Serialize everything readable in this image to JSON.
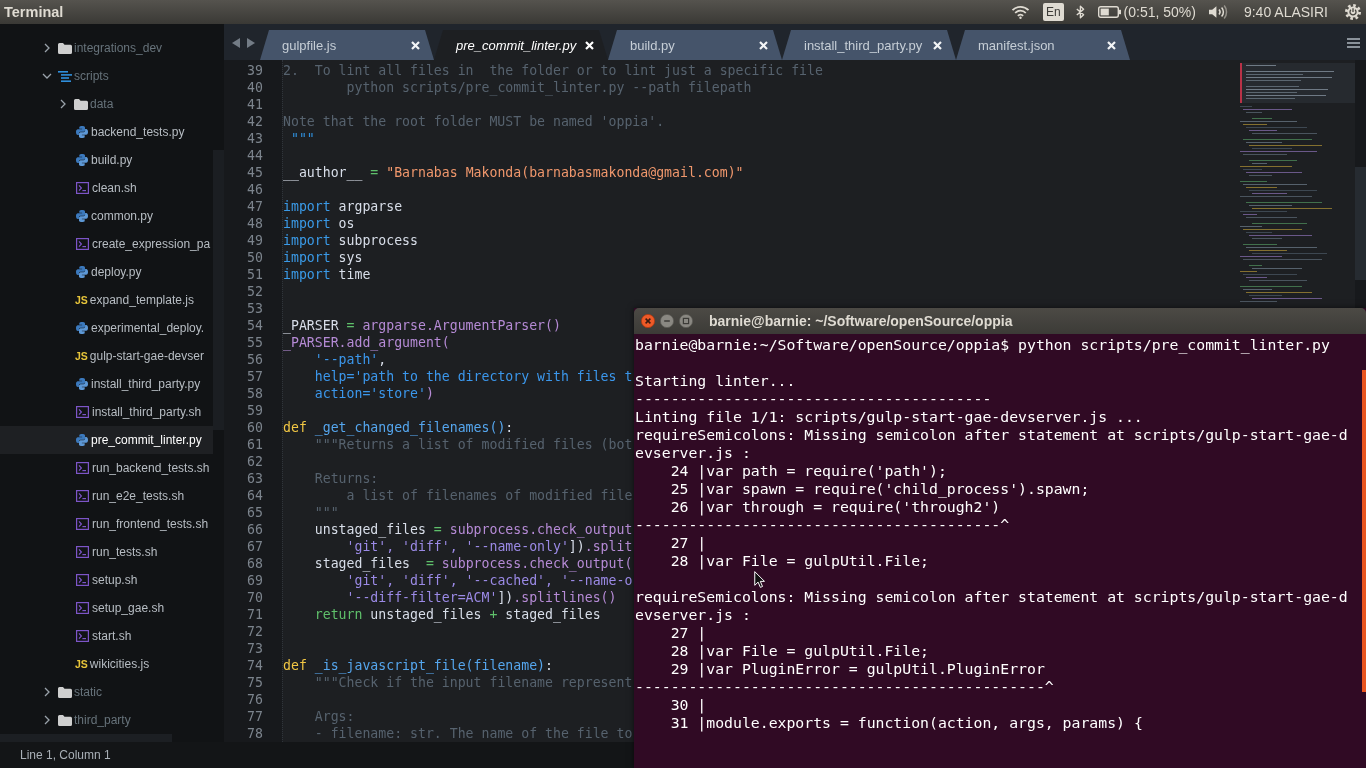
{
  "top_panel": {
    "app_title": "Terminal",
    "keyboard_layout": "En",
    "battery": "(0:51, 50%)",
    "clock": "9:40 ALASIRI"
  },
  "editor": {
    "sidebar": {
      "items": [
        {
          "label": "integrations_dev",
          "kind": "folder",
          "expanded": false,
          "selected": false
        },
        {
          "label": "scripts",
          "kind": "folder",
          "expanded": true,
          "selected": false,
          "children": [
            {
              "label": "data",
              "kind": "folder",
              "expanded": false,
              "selected": false
            },
            {
              "label": "backend_tests.py",
              "kind": "python",
              "selected": false
            },
            {
              "label": "build.py",
              "kind": "python",
              "selected": false
            },
            {
              "label": "clean.sh",
              "kind": "shell",
              "selected": false
            },
            {
              "label": "common.py",
              "kind": "python",
              "selected": false
            },
            {
              "label": "create_expression_pa",
              "kind": "shell",
              "selected": false
            },
            {
              "label": "deploy.py",
              "kind": "python",
              "selected": false
            },
            {
              "label": "expand_template.js",
              "kind": "javascript",
              "icon_label": "JS",
              "selected": false
            },
            {
              "label": "experimental_deploy.",
              "kind": "python",
              "selected": false
            },
            {
              "label": "gulp-start-gae-devser",
              "kind": "javascript",
              "icon_label": "JS",
              "selected": false
            },
            {
              "label": "install_third_party.py",
              "kind": "python",
              "selected": false
            },
            {
              "label": "install_third_party.sh",
              "kind": "shell",
              "selected": false
            },
            {
              "label": "pre_commit_linter.py",
              "kind": "python",
              "selected": true
            },
            {
              "label": "run_backend_tests.sh",
              "kind": "shell",
              "selected": false
            },
            {
              "label": "run_e2e_tests.sh",
              "kind": "shell",
              "selected": false
            },
            {
              "label": "run_frontend_tests.sh",
              "kind": "shell",
              "selected": false
            },
            {
              "label": "run_tests.sh",
              "kind": "shell",
              "selected": false
            },
            {
              "label": "setup.sh",
              "kind": "shell",
              "selected": false
            },
            {
              "label": "setup_gae.sh",
              "kind": "shell",
              "selected": false
            },
            {
              "label": "start.sh",
              "kind": "shell",
              "selected": false
            },
            {
              "label": "wikicities.js",
              "kind": "javascript",
              "icon_label": "JS",
              "selected": false
            }
          ]
        },
        {
          "label": "static",
          "kind": "folder",
          "expanded": false,
          "selected": false
        },
        {
          "label": "third_party",
          "kind": "folder",
          "expanded": false,
          "selected": false
        }
      ]
    },
    "tabs": [
      {
        "label": "gulpfile.js",
        "selected": false
      },
      {
        "label": "pre_commit_linter.py",
        "selected": true
      },
      {
        "label": "build.py",
        "selected": false
      },
      {
        "label": "install_third_party.py",
        "selected": false
      },
      {
        "label": "manifest.json",
        "selected": false
      }
    ],
    "lines": [
      {
        "number": "39",
        "tokens": [
          {
            "text": "2.  To lint all files in  the folder or to lint just a specific file",
            "kind": "comment"
          }
        ]
      },
      {
        "number": "40",
        "tokens": [
          {
            "text": "        python scripts/pre_commit_linter.py --path filepath",
            "kind": "comment"
          }
        ]
      },
      {
        "number": "41"
      },
      {
        "number": "42",
        "tokens": [
          {
            "text": "Note that the root folder MUST be named 'oppia'.",
            "kind": "comment"
          }
        ]
      },
      {
        "number": "43",
        "tokens": [
          {
            "text": " \"\"\"",
            "kind": "delimiter"
          }
        ]
      },
      {
        "number": "44"
      },
      {
        "number": "45",
        "tokens": [
          {
            "text": "__author__",
            "kind": "plain"
          },
          {
            "text": " = ",
            "kind": "operator"
          },
          {
            "text": "\"Barnabas Makonda(barnabasmakonda@gmail.com)\"",
            "kind": "string"
          }
        ]
      },
      {
        "number": "46"
      },
      {
        "number": "47",
        "tokens": [
          {
            "text": "import",
            "kind": "keyword"
          },
          {
            "text": " argparse",
            "kind": "plain"
          }
        ]
      },
      {
        "number": "48",
        "tokens": [
          {
            "text": "import",
            "kind": "keyword"
          },
          {
            "text": " os",
            "kind": "plain"
          }
        ]
      },
      {
        "number": "49",
        "tokens": [
          {
            "text": "import",
            "kind": "keyword"
          },
          {
            "text": " subprocess",
            "kind": "plain"
          }
        ]
      },
      {
        "number": "50",
        "tokens": [
          {
            "text": "import",
            "kind": "keyword"
          },
          {
            "text": " sys",
            "kind": "plain"
          }
        ]
      },
      {
        "number": "51",
        "tokens": [
          {
            "text": "import",
            "kind": "keyword"
          },
          {
            "text": " time",
            "kind": "plain"
          }
        ]
      },
      {
        "number": "52"
      },
      {
        "number": "53"
      },
      {
        "number": "54",
        "tokens": [
          {
            "text": "_PARSER",
            "kind": "plain"
          },
          {
            "text": " = ",
            "kind": "operator"
          },
          {
            "text": "argparse.ArgumentParser()",
            "kind": "call"
          }
        ]
      },
      {
        "number": "55",
        "tokens": [
          {
            "text": "_PARSER.add_argument(",
            "kind": "call"
          }
        ]
      },
      {
        "number": "56",
        "tokens": [
          {
            "text": "    '--path'",
            "kind": "argument"
          },
          {
            "text": ",",
            "kind": "plain"
          }
        ]
      },
      {
        "number": "57",
        "tokens": [
          {
            "text": "    help='path to the directory with files t",
            "kind": "argument"
          }
        ]
      },
      {
        "number": "58",
        "tokens": [
          {
            "text": "    action='store'",
            "kind": "argument"
          },
          {
            "text": ")",
            "kind": "call"
          }
        ]
      },
      {
        "number": "59"
      },
      {
        "number": "60",
        "tokens": [
          {
            "text": "def",
            "kind": "storage"
          },
          {
            "text": " _get_changed_filenames()",
            "kind": "function"
          },
          {
            "text": ":",
            "kind": "plain"
          }
        ]
      },
      {
        "number": "61",
        "tokens": [
          {
            "text": "    \"\"\"Returns a list of modified files (bot",
            "kind": "comment"
          }
        ]
      },
      {
        "number": "62"
      },
      {
        "number": "63",
        "tokens": [
          {
            "text": "    Returns:",
            "kind": "comment"
          }
        ]
      },
      {
        "number": "64",
        "tokens": [
          {
            "text": "        a list of filenames of modified file",
            "kind": "comment"
          }
        ]
      },
      {
        "number": "65",
        "tokens": [
          {
            "text": "    \"\"\"",
            "kind": "comment"
          }
        ]
      },
      {
        "number": "66",
        "tokens": [
          {
            "text": "    unstaged_files",
            "kind": "plain"
          },
          {
            "text": " = ",
            "kind": "operator"
          },
          {
            "text": "subprocess.check_output",
            "kind": "call"
          }
        ]
      },
      {
        "number": "67",
        "tokens": [
          {
            "text": "        'git', 'diff', '--name-only'",
            "kind": "literal"
          },
          {
            "text": "])",
            "kind": "plain"
          },
          {
            "text": ".split",
            "kind": "call"
          }
        ]
      },
      {
        "number": "68",
        "tokens": [
          {
            "text": "    staged_files",
            "kind": "plain"
          },
          {
            "text": "  = ",
            "kind": "operator"
          },
          {
            "text": "subprocess.check_output(",
            "kind": "call"
          }
        ]
      },
      {
        "number": "69",
        "tokens": [
          {
            "text": "        'git', 'diff', '--cached', '--name-o",
            "kind": "literal"
          }
        ]
      },
      {
        "number": "70",
        "tokens": [
          {
            "text": "        '--diff-filter=ACM'",
            "kind": "literal"
          },
          {
            "text": "])",
            "kind": "plain"
          },
          {
            "text": ".splitlines()",
            "kind": "call"
          }
        ]
      },
      {
        "number": "71",
        "tokens": [
          {
            "text": "    return",
            "kind": "control"
          },
          {
            "text": " unstaged_files ",
            "kind": "plain"
          },
          {
            "text": "+",
            "kind": "operator"
          },
          {
            "text": " staged_files",
            "kind": "plain"
          }
        ]
      },
      {
        "number": "72"
      },
      {
        "number": "73"
      },
      {
        "number": "74",
        "tokens": [
          {
            "text": "def",
            "kind": "storage"
          },
          {
            "text": " _is_javascript_file(filename)",
            "kind": "function"
          },
          {
            "text": ":",
            "kind": "plain"
          }
        ]
      },
      {
        "number": "75",
        "tokens": [
          {
            "text": "    \"\"\"Check if the input filename represent",
            "kind": "comment"
          }
        ]
      },
      {
        "number": "76"
      },
      {
        "number": "77",
        "tokens": [
          {
            "text": "    Args:",
            "kind": "comment"
          }
        ]
      },
      {
        "number": "78",
        "tokens": [
          {
            "text": "    - filename: str. The name of the file to",
            "kind": "comment"
          }
        ]
      }
    ],
    "status_bar": "Line 1, Column 1"
  },
  "terminal": {
    "title": "barnie@barnie: ~/Software/openSource/oppia",
    "blocks": [
      {
        "lines": [
          "barnie@barnie:~/Software/openSource/oppia$ python scripts/pre_commit_linter.py"
        ]
      },
      {
        "lines": [
          "Starting linter...",
          "----------------------------------------",
          "Linting file 1/1: scripts/gulp-start-gae-devserver.js ...",
          "requireSemicolons: Missing semicolon after statement at scripts/gulp-start-gae-d",
          "evserver.js :",
          "    24 |var path = require('path');",
          "    25 |var spawn = require('child_process').spawn;",
          "    26 |var through = require('through2')",
          "-----------------------------------------^",
          "    27 |",
          "    28 |var File = gulpUtil.File;"
        ]
      },
      {
        "lines": [
          "requireSemicolons: Missing semicolon after statement at scripts/gulp-start-gae-d",
          "evserver.js :",
          "    27 |",
          "    28 |var File = gulpUtil.File;",
          "    29 |var PluginError = gulpUtil.PluginError",
          "----------------------------------------------^",
          "    30 |",
          "    31 |module.exports = function(action, args, params) {"
        ]
      }
    ]
  }
}
